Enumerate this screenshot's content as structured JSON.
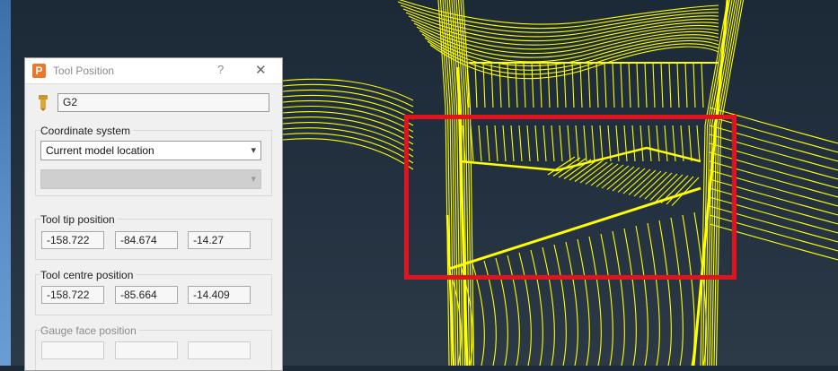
{
  "dialog": {
    "title": "Tool Position",
    "app_icon_letter": "P",
    "help_label": "?",
    "close_label": "✕",
    "tool_name": "G2",
    "coordinate_system": {
      "label": "Coordinate system",
      "selected": "Current model location",
      "secondary_selected": ""
    },
    "tool_tip_position": {
      "label": "Tool tip position",
      "x": "-158.722",
      "y": "-84.674",
      "z": "-14.27"
    },
    "tool_centre_position": {
      "label": "Tool centre position",
      "x": "-158.722",
      "y": "-85.664",
      "z": "-14.409"
    },
    "gauge_face_position": {
      "label": "Gauge face position",
      "x": "",
      "y": "",
      "z": ""
    }
  },
  "colors": {
    "toolpath": "#ffff00",
    "highlight": "#e0141c",
    "background": "#1f2d3b"
  },
  "icons": {
    "chevron": "▾"
  }
}
